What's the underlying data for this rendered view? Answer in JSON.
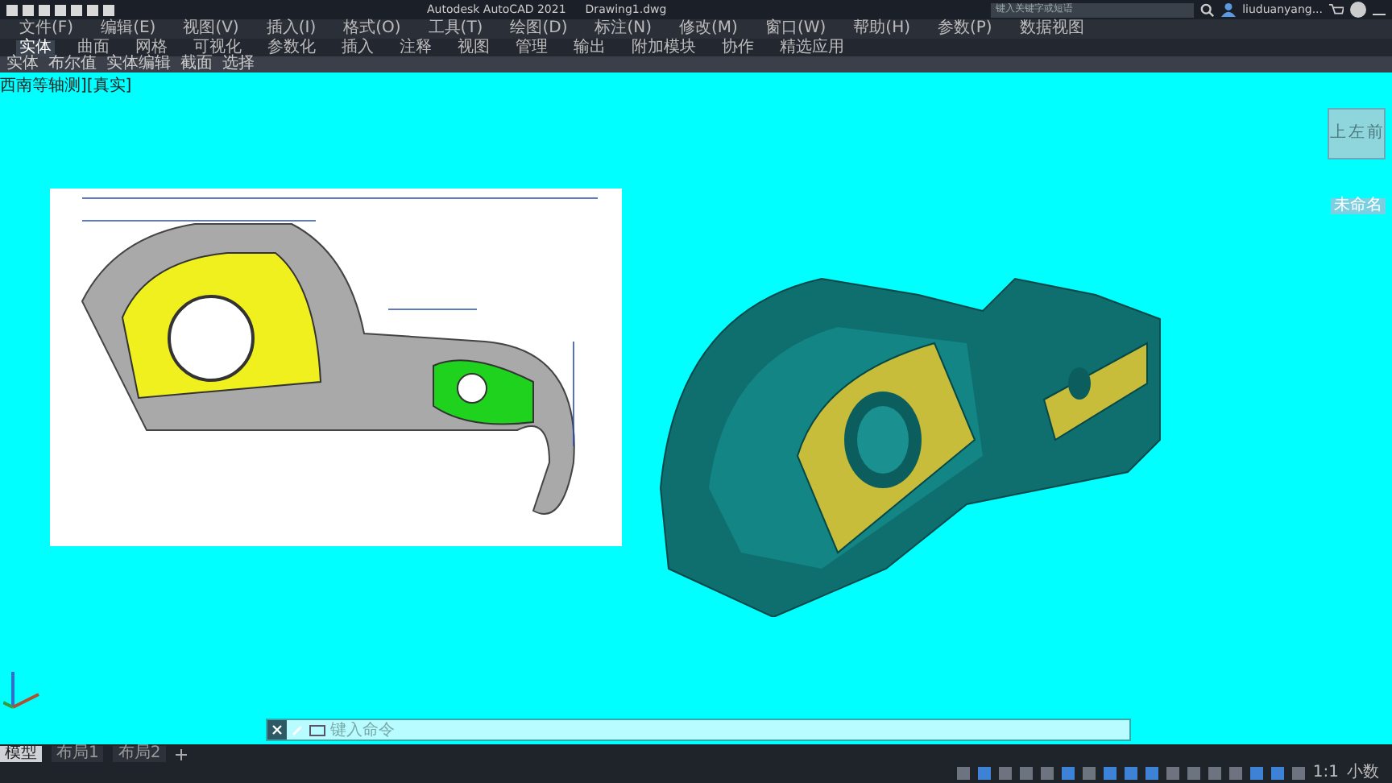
{
  "window": {
    "title": "Autodesk AutoCAD 2021",
    "document": "Drawing1.dwg"
  },
  "search": {
    "placeholder": "键入关键字或短语"
  },
  "user": {
    "name": "liuduanyang..."
  },
  "menu": [
    "文件(F)",
    "编辑(E)",
    "视图(V)",
    "插入(I)",
    "格式(O)",
    "工具(T)",
    "绘图(D)",
    "标注(N)",
    "修改(M)",
    "窗口(W)",
    "帮助(H)",
    "参数(P)",
    "数据视图"
  ],
  "ribbon_tabs": [
    {
      "label": "实体",
      "selected": true
    },
    {
      "label": "曲面",
      "selected": false
    },
    {
      "label": "网格",
      "selected": false
    },
    {
      "label": "可视化",
      "selected": false
    },
    {
      "label": "参数化",
      "selected": false
    },
    {
      "label": "插入",
      "selected": false
    },
    {
      "label": "注释",
      "selected": false
    },
    {
      "label": "视图",
      "selected": false
    },
    {
      "label": "管理",
      "selected": false
    },
    {
      "label": "输出",
      "selected": false
    },
    {
      "label": "附加模块",
      "selected": false
    },
    {
      "label": "协作",
      "selected": false
    },
    {
      "label": "精选应用",
      "selected": false
    }
  ],
  "panels": [
    "实体",
    "布尔值",
    "实体编辑",
    "截面",
    "选择"
  ],
  "viewport": {
    "label": "西南等轴测][真实]"
  },
  "viewcube": {
    "faces": [
      "上",
      "左",
      "前"
    ],
    "wcs": "未命名"
  },
  "command_line": {
    "placeholder": "键入命令"
  },
  "layout_tabs": [
    {
      "label": "模型",
      "selected": true
    },
    {
      "label": "布局1",
      "selected": false
    },
    {
      "label": "布局2",
      "selected": false
    }
  ],
  "status_toggles": [
    {
      "on": false
    },
    {
      "on": true
    },
    {
      "on": false
    },
    {
      "on": false
    },
    {
      "on": false
    },
    {
      "on": true
    },
    {
      "on": false
    },
    {
      "on": true
    },
    {
      "on": true
    },
    {
      "on": true
    },
    {
      "on": false
    },
    {
      "on": false
    },
    {
      "on": false
    },
    {
      "on": false
    },
    {
      "on": true
    },
    {
      "on": true
    },
    {
      "on": false
    }
  ],
  "status_bar": {
    "scale": "1:1",
    "units": "小数"
  }
}
